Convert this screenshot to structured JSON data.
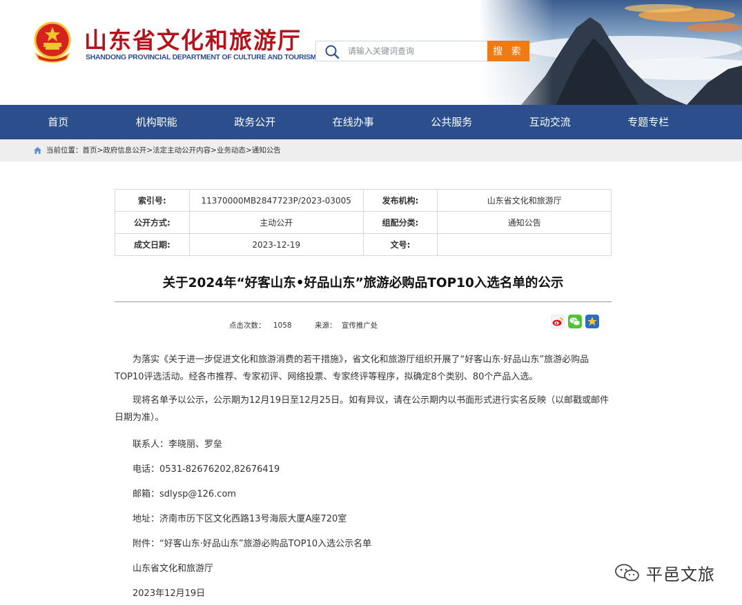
{
  "header": {
    "title": "山东省文化和旅游厅",
    "subtitle": "SHANDONG PROVINCIAL DEPARTMENT OF CULTURE AND TOURISM",
    "search_placeholder": "请输入关键词查询",
    "search_button": "搜 索",
    "accent_color": "#f07a14",
    "title_color": "#b5121b"
  },
  "nav": {
    "items": [
      "首页",
      "机构职能",
      "政务公开",
      "在线办事",
      "公共服务",
      "互动交流",
      "专题专栏"
    ],
    "color": "#2b4f8c"
  },
  "breadcrumb": {
    "label": "当前位置：",
    "items": [
      "首页",
      "政府信息公开",
      "法定主动公开内容",
      "业务动态",
      "通知公告"
    ],
    "separator": ">"
  },
  "info": {
    "index_label": "索引号:",
    "index_value": "11370000MB2847723P/2023-03005",
    "org_label": "发布机构:",
    "org_value": "山东省文化和旅游厅",
    "method_label": "公开方式:",
    "method_value": "主动公开",
    "category_label": "组配分类:",
    "category_value": "通知公告",
    "date_label": "成文日期:",
    "date_value": "2023-12-19",
    "doc_label": "文号:",
    "doc_value": ""
  },
  "article": {
    "title": "关于2024年“好客山东•好品山东”旅游必购品TOP10入选名单的公示",
    "views_label": "点击次数：",
    "views": "1058",
    "source_label": "来源：",
    "source": "宣传推广处",
    "p1": "为落实《关于进一步促进文化和旅游消费的若干措施》，省文化和旅游厅组织开展了“好客山东·好品山东”旅游必购品TOP10评选活动。经各市推荐、专家初评、网络投票、专家终评等程序，拟确定8个类别、80个产品入选。",
    "p2": "现将名单予以公示，公示期为12月19日至12月25日。如有异议，请在公示期内以书面形式进行实名反映（以邮戳或邮件日期为准）。",
    "contact": "联系人：李晓丽、罗垒",
    "phone": "电话：0531-82676202,82676419",
    "email": "邮箱：sdlysp@126.com",
    "address": "地址：济南市历下区文化西路13号海辰大厦A座720室",
    "attachment": "附件：“好客山东·好品山东”旅游必购品TOP10入选公示名单",
    "signature": "山东省文化和旅游厅",
    "sign_date": "2023年12月19日"
  },
  "share": {
    "icons": [
      "weibo-icon",
      "wechat-icon",
      "favorite-star-icon"
    ]
  },
  "watermark": {
    "text": "平邑文旅"
  }
}
